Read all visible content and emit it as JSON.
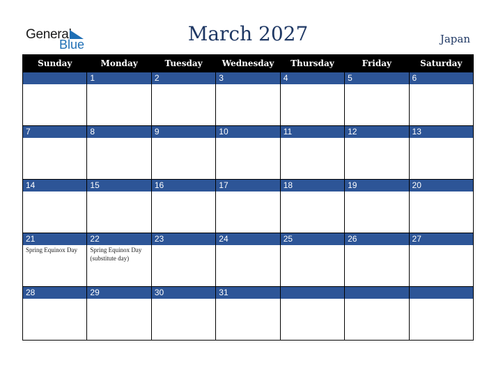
{
  "logo": {
    "word1": "General",
    "word2": "Blue"
  },
  "title": "March 2027",
  "country": "Japan",
  "colors": {
    "header_bg": "#000000",
    "day_band": "#2d5597",
    "title": "#1f3864",
    "logo_blue": "#1f6fb5"
  },
  "weekdays": [
    "Sunday",
    "Monday",
    "Tuesday",
    "Wednesday",
    "Thursday",
    "Friday",
    "Saturday"
  ],
  "weeks": [
    [
      {
        "day": "",
        "event": ""
      },
      {
        "day": "1",
        "event": ""
      },
      {
        "day": "2",
        "event": ""
      },
      {
        "day": "3",
        "event": ""
      },
      {
        "day": "4",
        "event": ""
      },
      {
        "day": "5",
        "event": ""
      },
      {
        "day": "6",
        "event": ""
      }
    ],
    [
      {
        "day": "7",
        "event": ""
      },
      {
        "day": "8",
        "event": ""
      },
      {
        "day": "9",
        "event": ""
      },
      {
        "day": "10",
        "event": ""
      },
      {
        "day": "11",
        "event": ""
      },
      {
        "day": "12",
        "event": ""
      },
      {
        "day": "13",
        "event": ""
      }
    ],
    [
      {
        "day": "14",
        "event": ""
      },
      {
        "day": "15",
        "event": ""
      },
      {
        "day": "16",
        "event": ""
      },
      {
        "day": "17",
        "event": ""
      },
      {
        "day": "18",
        "event": ""
      },
      {
        "day": "19",
        "event": ""
      },
      {
        "day": "20",
        "event": ""
      }
    ],
    [
      {
        "day": "21",
        "event": "Spring Equinox Day"
      },
      {
        "day": "22",
        "event": "Spring Equinox Day (substitute day)"
      },
      {
        "day": "23",
        "event": ""
      },
      {
        "day": "24",
        "event": ""
      },
      {
        "day": "25",
        "event": ""
      },
      {
        "day": "26",
        "event": ""
      },
      {
        "day": "27",
        "event": ""
      }
    ],
    [
      {
        "day": "28",
        "event": ""
      },
      {
        "day": "29",
        "event": ""
      },
      {
        "day": "30",
        "event": ""
      },
      {
        "day": "31",
        "event": ""
      },
      {
        "day": "",
        "event": ""
      },
      {
        "day": "",
        "event": ""
      },
      {
        "day": "",
        "event": ""
      }
    ]
  ]
}
